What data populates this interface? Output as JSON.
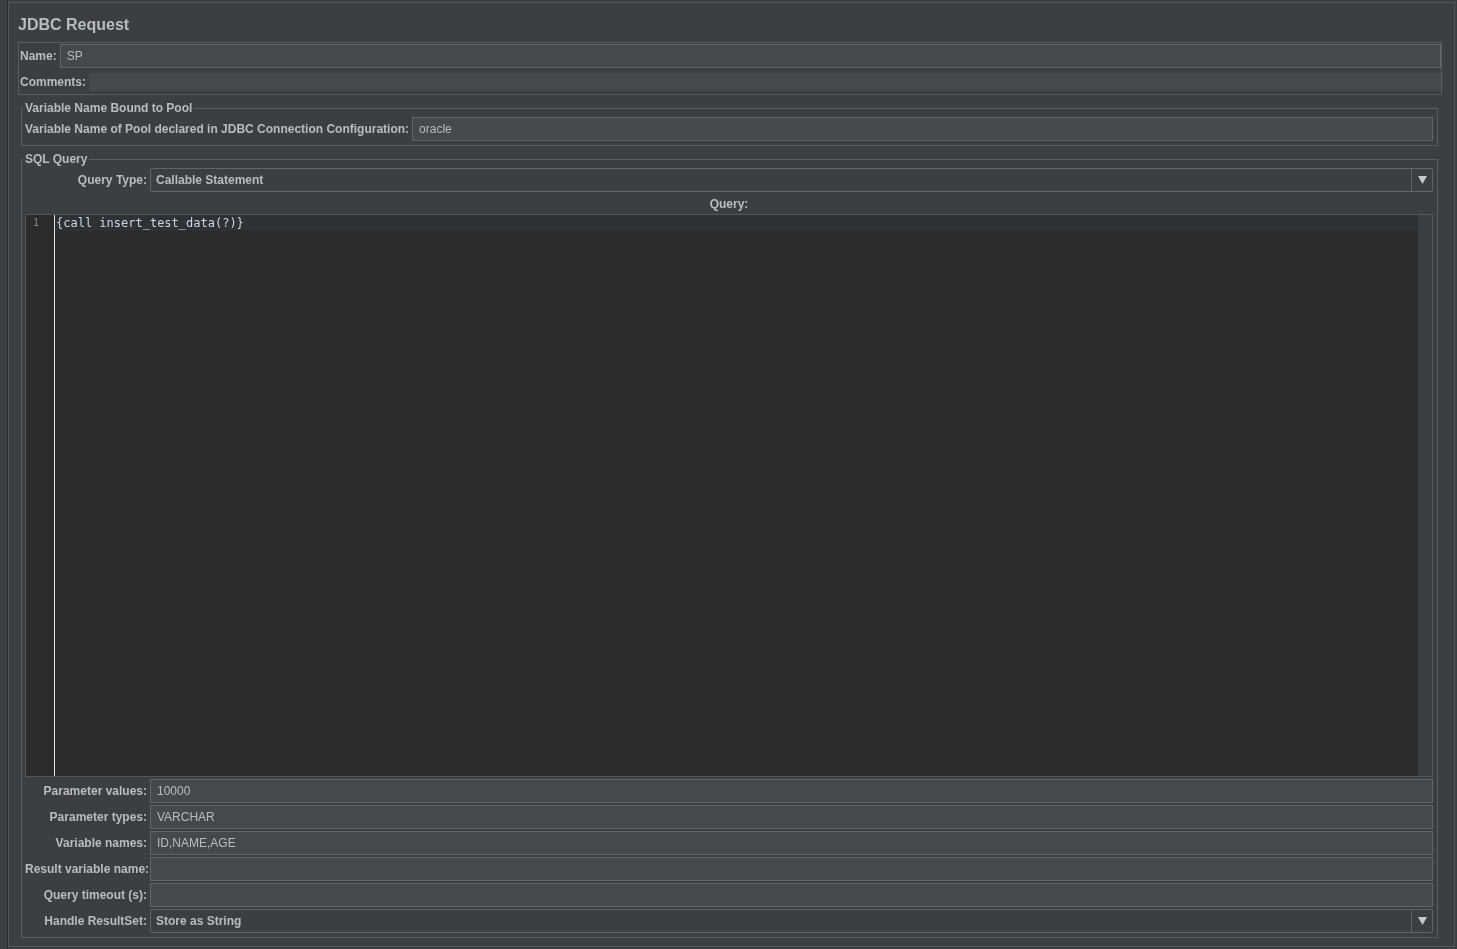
{
  "title": "JDBC Request",
  "name": {
    "label": "Name:",
    "value": "SP"
  },
  "comments": {
    "label": "Comments:"
  },
  "pool": {
    "legend": "Variable Name Bound to Pool",
    "label": "Variable Name of Pool declared in JDBC Connection Configuration:",
    "value": "oracle"
  },
  "sql": {
    "legend": "SQL Query",
    "query_type": {
      "label": "Query Type:",
      "value": "Callable Statement"
    },
    "query_label": "Query:",
    "editor": {
      "lines": [
        {
          "number": "1",
          "code": "{call insert_test_data(?)}"
        }
      ]
    },
    "fields": [
      {
        "kind": "text",
        "label": "Parameter values:",
        "value": "10000"
      },
      {
        "kind": "text",
        "label": "Parameter types:",
        "value": "VARCHAR"
      },
      {
        "kind": "text",
        "label": "Variable names:",
        "value": "ID,NAME,AGE"
      },
      {
        "kind": "text",
        "label": "Result variable name:"
      },
      {
        "kind": "text",
        "label": "Query timeout (s):"
      },
      {
        "kind": "dropdown",
        "label": "Handle ResultSet:",
        "value": "Store as String"
      }
    ]
  }
}
